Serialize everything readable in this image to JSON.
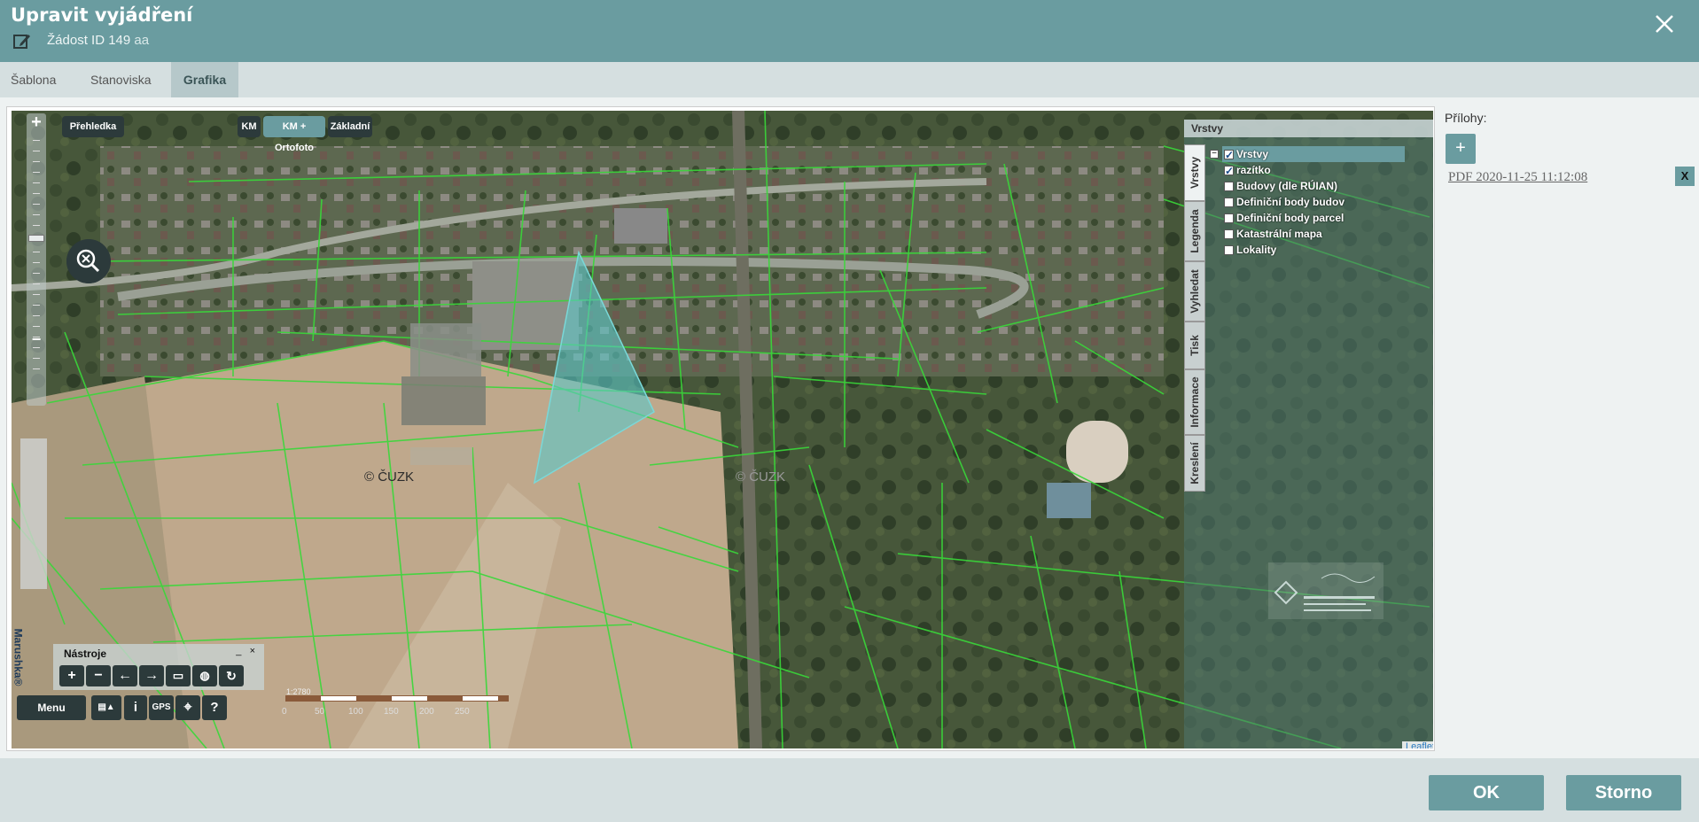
{
  "dialog": {
    "title": "Upravit vyjádření",
    "subtitle_main": "Žádost ID 149",
    "subtitle_extra": "aa"
  },
  "tabs": [
    {
      "label": "Šablona"
    },
    {
      "label": "Stanoviska"
    },
    {
      "label": "Grafika"
    }
  ],
  "map": {
    "overview_button": "Přehledka",
    "basemaps": [
      "KM",
      "KM + Ortofoto",
      "Základní"
    ],
    "active_basemap": "KM + Ortofoto",
    "watermark": "© ČUZK",
    "watermark_2": "© ČUZK",
    "brand": "Marushka®",
    "attribution": "Leaflet",
    "scale_labels": [
      "0",
      "50",
      "100",
      "150",
      "200",
      "250"
    ],
    "scale_ratio": "1:2780",
    "tools": {
      "title": "Nástroje",
      "minimize": "_",
      "close": "×"
    },
    "bottom": {
      "menu": "Menu",
      "info": "i",
      "gps": "GPS",
      "help": "?"
    }
  },
  "layers_panel": {
    "title": "Vrstvy",
    "vertical_tabs": [
      "Vrstvy",
      "Legenda",
      "Vyhledat",
      "Tisk",
      "Informace",
      "Kreslení"
    ],
    "layers": [
      {
        "label": "Vrstvy",
        "checked": true
      },
      {
        "label": "razítko",
        "checked": true
      },
      {
        "label": "Budovy (dle RÚIAN)",
        "checked": false
      },
      {
        "label": "Definiční body budov",
        "checked": false
      },
      {
        "label": "Definiční body parcel",
        "checked": false
      },
      {
        "label": "Katastrální mapa",
        "checked": false
      },
      {
        "label": "Lokality",
        "checked": false
      }
    ]
  },
  "attachments": {
    "label": "Přílohy:",
    "add": "+",
    "file": "PDF 2020-11-25 11:12:08",
    "delete": "X"
  },
  "footer": {
    "ok": "OK",
    "cancel": "Storno"
  },
  "colors": {
    "header": "#6a9ca0",
    "parcel_lines": "#39d839",
    "polygon": "#5cc8c8"
  }
}
